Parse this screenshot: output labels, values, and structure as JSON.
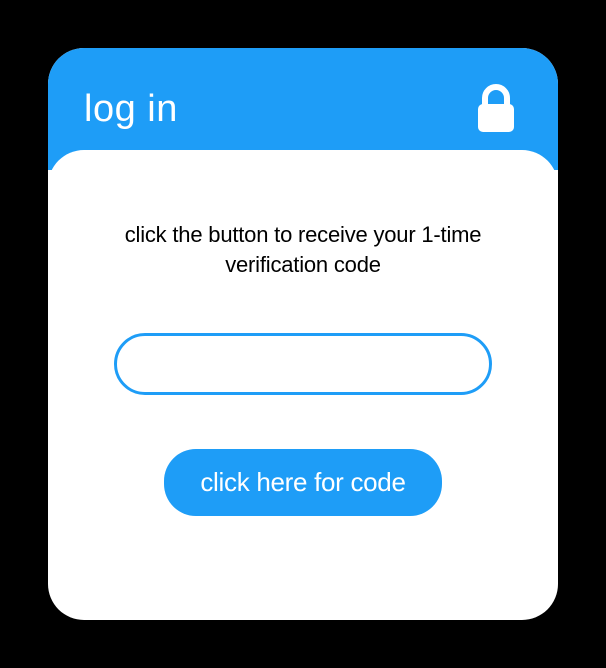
{
  "header": {
    "title": "log in"
  },
  "body": {
    "instruction": "click the button to receive your 1-time verification code",
    "input_value": "",
    "button_label": "click here for code"
  }
}
